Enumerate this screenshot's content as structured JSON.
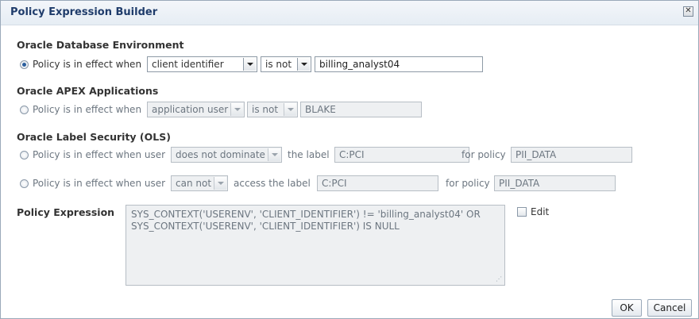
{
  "dialog": {
    "title": "Policy Expression Builder",
    "close_icon": "close-icon"
  },
  "oracle_db": {
    "section_title": "Oracle Database Environment",
    "radio_label": "Policy is in effect when",
    "selected": true,
    "attribute_select": "client identifier",
    "operator_select": "is not",
    "value_input": "billing_analyst04"
  },
  "apex": {
    "section_title": "Oracle APEX Applications",
    "radio_label": "Policy is in effect when",
    "selected": false,
    "attribute_select": "application user",
    "operator_select": "is not",
    "value_input": "BLAKE"
  },
  "ols": {
    "section_title": "Oracle Label Security (OLS)",
    "row1": {
      "radio_label": "Policy is in effect when user",
      "selected": false,
      "relation_select": "does not dominate",
      "label_text": "the label",
      "label_input": "C:PCI",
      "policy_text": "for policy",
      "policy_input": "PII_DATA"
    },
    "row2": {
      "radio_label": "Policy is in effect when user",
      "selected": false,
      "relation_select": "can not",
      "label_text": "access the label",
      "label_input": "C:PCI",
      "policy_text": "for policy",
      "policy_input": "PII_DATA"
    }
  },
  "expression": {
    "label": "Policy Expression",
    "lines": [
      "SYS_CONTEXT('USERENV', 'CLIENT_IDENTIFIER') != 'billing_analyst04' OR",
      "SYS_CONTEXT('USERENV', 'CLIENT_IDENTIFIER') IS NULL"
    ],
    "edit_label": "Edit",
    "edit_checked": false
  },
  "buttons": {
    "ok": "OK",
    "cancel": "Cancel"
  },
  "colors": {
    "title": "#1f3c6b",
    "radio_selected": "#2b5f9e",
    "disabled_field": "#eef0f2"
  }
}
